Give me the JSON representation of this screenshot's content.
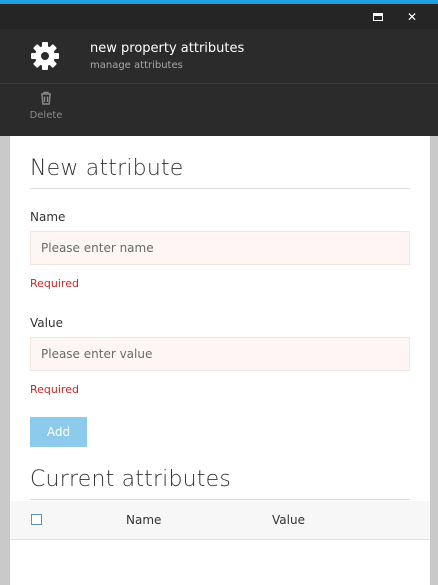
{
  "window": {
    "accent_color": "#1ba1e2",
    "controls": {
      "maximize_icon": "maximize-icon",
      "close_icon": "close-icon",
      "close_glyph": "✕"
    }
  },
  "header": {
    "icon": "gear-icon",
    "title": "new property attributes",
    "subtitle": "manage attributes"
  },
  "toolbar": {
    "delete": {
      "icon": "trash-icon",
      "label": "Delete"
    }
  },
  "form": {
    "section_title": "New attribute",
    "name": {
      "label": "Name",
      "placeholder": "Please enter name",
      "value": "",
      "validation": "Required"
    },
    "value": {
      "label": "Value",
      "placeholder": "Please enter value",
      "value": "",
      "validation": "Required"
    },
    "add_button": "Add"
  },
  "current": {
    "section_title": "Current attributes",
    "columns": [
      "Name",
      "Value"
    ],
    "rows": []
  }
}
